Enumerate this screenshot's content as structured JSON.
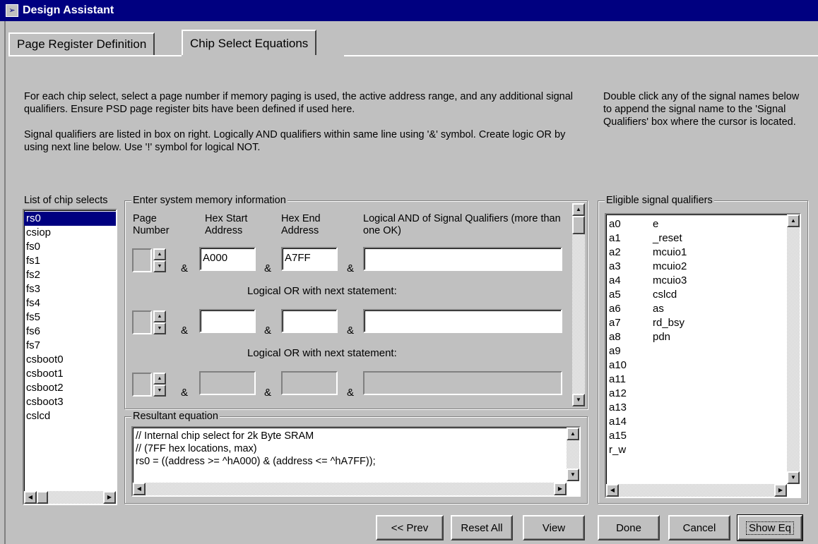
{
  "window": {
    "title": "Design Assistant"
  },
  "tabs": [
    {
      "label": "Page Register Definition",
      "active": false
    },
    {
      "label": "Chip Select Equations",
      "active": true
    }
  ],
  "instructions": {
    "para1": "For each chip select, select a page number if memory paging is used, the active address range, and any additional signal qualifiers. Ensure PSD page register bits have been defined if used here.",
    "para2": "Signal qualifiers are listed in box on right. Logically AND qualifiers within same line using '&' symbol. Create logic OR by using next line below. Use '!' symbol for logical NOT.",
    "right": "Double click any of the signal names below to append the signal name to the 'Signal Qualifiers' box where the cursor is located."
  },
  "chip_selects": {
    "label": "List of chip selects",
    "items": [
      "rs0",
      "csiop",
      "fs0",
      "fs1",
      "fs2",
      "fs3",
      "fs4",
      "fs5",
      "fs6",
      "fs7",
      "csboot0",
      "csboot1",
      "csboot2",
      "csboot3",
      "cslcd"
    ],
    "selected": "rs0"
  },
  "memory": {
    "label": "Enter system memory information",
    "headers": {
      "page": "Page Number",
      "start": "Hex Start Address",
      "end": "Hex End Address",
      "qual": "Logical AND of Signal Qualifiers (more than one OK)"
    },
    "amp": "&",
    "or_label": "Logical OR with next statement:",
    "rows": [
      {
        "start": "A000",
        "end": "A7FF",
        "qual": "",
        "enabled": true
      },
      {
        "start": "",
        "end": "",
        "qual": "",
        "enabled": true
      },
      {
        "start": "",
        "end": "",
        "qual": "",
        "enabled": false
      }
    ]
  },
  "resultant": {
    "label": "Resultant equation",
    "lines": [
      "// Internal chip select for 2k Byte SRAM",
      "// (7FF hex locations, max)",
      "rs0 = ((address >= ^hA000) & (address <= ^hA7FF));"
    ]
  },
  "qualifiers": {
    "label": "Eligible signal qualifiers",
    "col1": [
      "a0",
      "a1",
      "a2",
      "a3",
      "a4",
      "a5",
      "a6",
      "a7",
      "a8",
      "a9",
      "a10",
      "a11",
      "a12",
      "a13",
      "a14",
      "a15",
      "r_w"
    ],
    "col2": [
      "e",
      "_reset",
      "mcuio1",
      "mcuio2",
      "mcuio3",
      "cslcd",
      "as",
      "rd_bsy",
      "pdn"
    ]
  },
  "buttons": {
    "prev": "<< Prev",
    "reset": "Reset All",
    "view": "View",
    "done": "Done",
    "cancel": "Cancel",
    "show_eq": "Show Eq"
  },
  "icons": {
    "scroll_up": "▲",
    "scroll_down": "▼",
    "scroll_left": "◀",
    "scroll_right": "▶",
    "app": "➢"
  }
}
